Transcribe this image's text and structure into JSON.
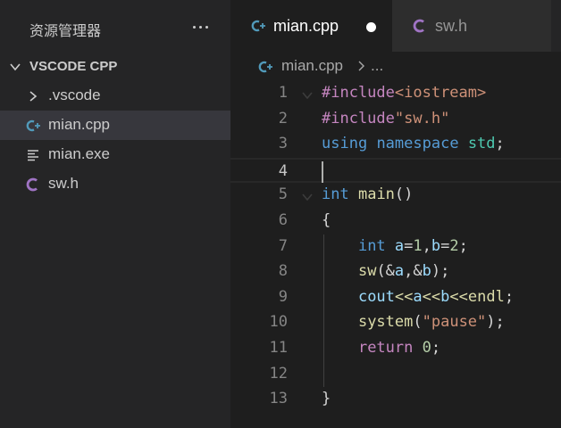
{
  "sidebar": {
    "title": "资源管理器",
    "section_label": "VSCODE CPP",
    "items": [
      {
        "label": ".vscode",
        "icon": "chevron-right-icon"
      },
      {
        "label": "mian.cpp",
        "icon": "cpp-file-icon",
        "selected": true
      },
      {
        "label": "mian.exe",
        "icon": "exe-file-icon"
      },
      {
        "label": "sw.h",
        "icon": "c-header-file-icon"
      }
    ]
  },
  "tabs": [
    {
      "label": "mian.cpp",
      "icon": "cpp-file-icon",
      "active": true,
      "dirty": true
    },
    {
      "label": "sw.h",
      "icon": "c-header-file-icon",
      "active": false
    }
  ],
  "breadcrumb": {
    "file": "mian.cpp",
    "more": "..."
  },
  "editor": {
    "current_line": 4,
    "lines": [
      {
        "n": "1",
        "tokens": [
          [
            "#include",
            "pp"
          ],
          [
            "<iostream>",
            "inc"
          ]
        ]
      },
      {
        "n": "2",
        "tokens": [
          [
            "#include",
            "pp"
          ],
          [
            "\"sw.h\"",
            "inc"
          ]
        ]
      },
      {
        "n": "3",
        "tokens": [
          [
            "using",
            "kw"
          ],
          [
            " ",
            "punc"
          ],
          [
            "namespace",
            "kw"
          ],
          [
            " ",
            "punc"
          ],
          [
            "std",
            "type"
          ],
          [
            ";",
            "punc"
          ]
        ]
      },
      {
        "n": "4",
        "tokens": []
      },
      {
        "n": "5",
        "tokens": [
          [
            "int",
            "kw"
          ],
          [
            " ",
            "punc"
          ],
          [
            "main",
            "fn"
          ],
          [
            "()",
            "punc"
          ]
        ]
      },
      {
        "n": "6",
        "tokens": [
          [
            "{",
            "punc"
          ]
        ]
      },
      {
        "n": "7",
        "tokens": [
          [
            "    ",
            "punc"
          ],
          [
            "int",
            "kw"
          ],
          [
            " ",
            "punc"
          ],
          [
            "a",
            "var"
          ],
          [
            "=",
            "punc"
          ],
          [
            "1",
            "num"
          ],
          [
            ",",
            "punc"
          ],
          [
            "b",
            "var"
          ],
          [
            "=",
            "punc"
          ],
          [
            "2",
            "num"
          ],
          [
            ";",
            "punc"
          ]
        ]
      },
      {
        "n": "8",
        "tokens": [
          [
            "    ",
            "punc"
          ],
          [
            "sw",
            "fn"
          ],
          [
            "(&",
            "punc"
          ],
          [
            "a",
            "var"
          ],
          [
            ",&",
            "punc"
          ],
          [
            "b",
            "var"
          ],
          [
            ");",
            "punc"
          ]
        ]
      },
      {
        "n": "9",
        "tokens": [
          [
            "    ",
            "punc"
          ],
          [
            "cout",
            "var"
          ],
          [
            "<<",
            "fn"
          ],
          [
            "a",
            "var"
          ],
          [
            "<<",
            "fn"
          ],
          [
            "b",
            "var"
          ],
          [
            "<<",
            "fn"
          ],
          [
            "endl",
            "fn"
          ],
          [
            ";",
            "punc"
          ]
        ]
      },
      {
        "n": "10",
        "tokens": [
          [
            "    ",
            "punc"
          ],
          [
            "system",
            "fn"
          ],
          [
            "(",
            "punc"
          ],
          [
            "\"pause\"",
            "str"
          ],
          [
            ");",
            "punc"
          ]
        ]
      },
      {
        "n": "11",
        "tokens": [
          [
            "    ",
            "punc"
          ],
          [
            "return",
            "ctrl"
          ],
          [
            " ",
            "punc"
          ],
          [
            "0",
            "num"
          ],
          [
            ";",
            "punc"
          ]
        ]
      },
      {
        "n": "12",
        "tokens": []
      },
      {
        "n": "13",
        "tokens": [
          [
            "}",
            "punc"
          ]
        ]
      }
    ]
  },
  "colors": {
    "background": "#1e1e1e",
    "sidebar": "#252526",
    "cpp_icon": "#519aba",
    "header_icon": "#a074c4"
  }
}
